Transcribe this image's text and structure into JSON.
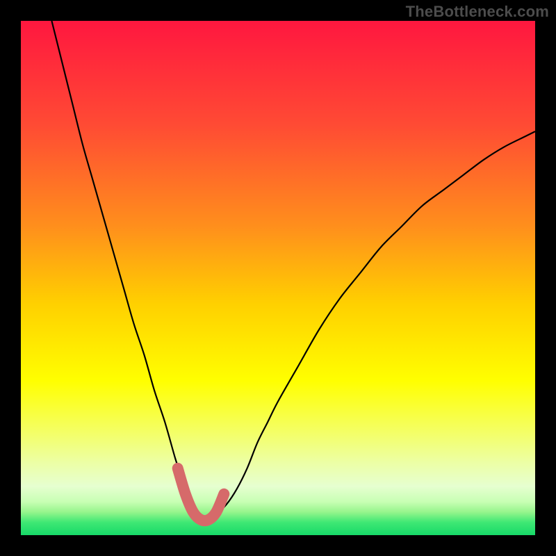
{
  "watermark": "TheBottleneck.com",
  "colors": {
    "page_bg": "#000000",
    "watermark": "#4c4c4c",
    "curve": "#000000",
    "marker_fill": "#d66a6a",
    "marker_stroke": "#c05050",
    "gradient_stops": [
      {
        "offset": 0.0,
        "color": "#ff173f"
      },
      {
        "offset": 0.2,
        "color": "#ff4a34"
      },
      {
        "offset": 0.4,
        "color": "#ff8f1c"
      },
      {
        "offset": 0.55,
        "color": "#ffd000"
      },
      {
        "offset": 0.7,
        "color": "#ffff00"
      },
      {
        "offset": 0.8,
        "color": "#f4ff66"
      },
      {
        "offset": 0.86,
        "color": "#ecffa6"
      },
      {
        "offset": 0.905,
        "color": "#e6ffd0"
      },
      {
        "offset": 0.935,
        "color": "#c8ffb4"
      },
      {
        "offset": 0.955,
        "color": "#96f58c"
      },
      {
        "offset": 0.975,
        "color": "#3fe874"
      },
      {
        "offset": 1.0,
        "color": "#17d968"
      }
    ]
  },
  "chart_data": {
    "type": "line",
    "title": "",
    "xlabel": "",
    "ylabel": "",
    "xlim": [
      0,
      100
    ],
    "ylim": [
      0,
      100
    ],
    "grid": false,
    "legend": false,
    "series": [
      {
        "name": "bottleneck-curve",
        "x": [
          6,
          8,
          10,
          12,
          14,
          16,
          18,
          20,
          22,
          24,
          26,
          28,
          30,
          31,
          32,
          33,
          34,
          35,
          36,
          37,
          38,
          40,
          42,
          44,
          46,
          48,
          50,
          54,
          58,
          62,
          66,
          70,
          74,
          78,
          82,
          86,
          90,
          94,
          98,
          100
        ],
        "y": [
          100,
          92,
          84,
          76,
          69,
          62,
          55,
          48,
          41,
          35,
          28,
          22,
          15,
          12,
          9,
          6,
          4,
          3,
          3,
          3,
          4,
          6,
          9,
          13,
          18,
          22,
          26,
          33,
          40,
          46,
          51,
          56,
          60,
          64,
          67,
          70,
          73,
          75.5,
          77.5,
          78.5
        ]
      }
    ],
    "markers": {
      "name": "highlight-points",
      "x": [
        30.5,
        32,
        33.5,
        35,
        36.5,
        38,
        39.5
      ],
      "y": [
        13,
        8,
        4.5,
        3,
        3,
        4.5,
        8
      ]
    }
  }
}
